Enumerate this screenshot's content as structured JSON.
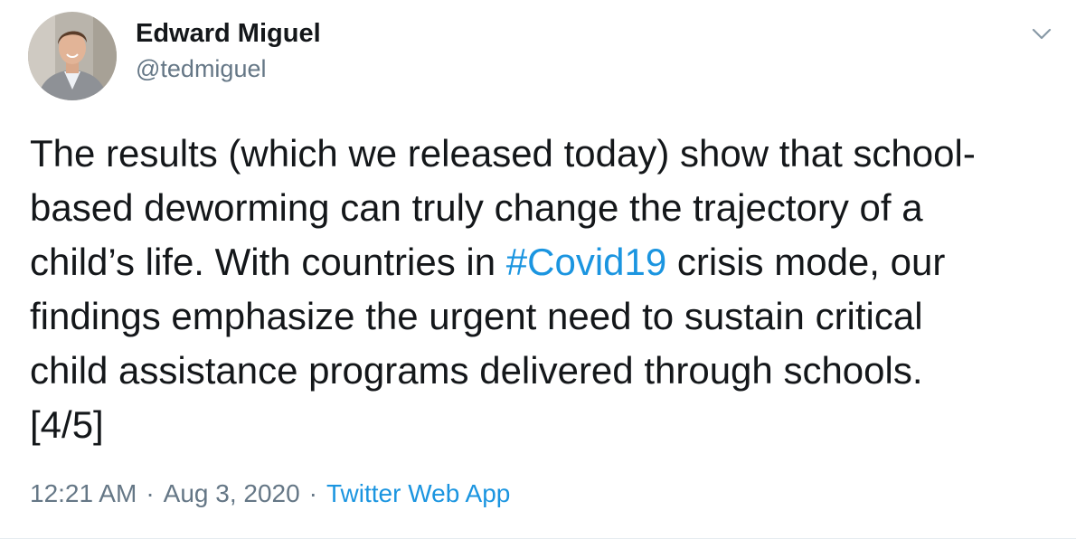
{
  "author": {
    "display_name": "Edward Miguel",
    "handle": "@tedmiguel"
  },
  "tweet": {
    "text_before": "The results (which we released today) show that school-\nbased deworming can truly change the trajectory of a\nchild’s life. With countries in ",
    "hashtag": "#Covid19",
    "text_after": " crisis mode, our\nfindings emphasize the urgent need to sustain critical\nchild assistance programs delivered through schools.\n[4/5]"
  },
  "meta": {
    "time": "12:21 AM",
    "separator": "·",
    "date": "Aug 3, 2020",
    "source": "Twitter Web App"
  },
  "icons": {
    "caret": "chevron-down-icon"
  },
  "colors": {
    "link": "#1b95e0",
    "secondary_text": "#657786",
    "primary_text": "#14171a"
  }
}
